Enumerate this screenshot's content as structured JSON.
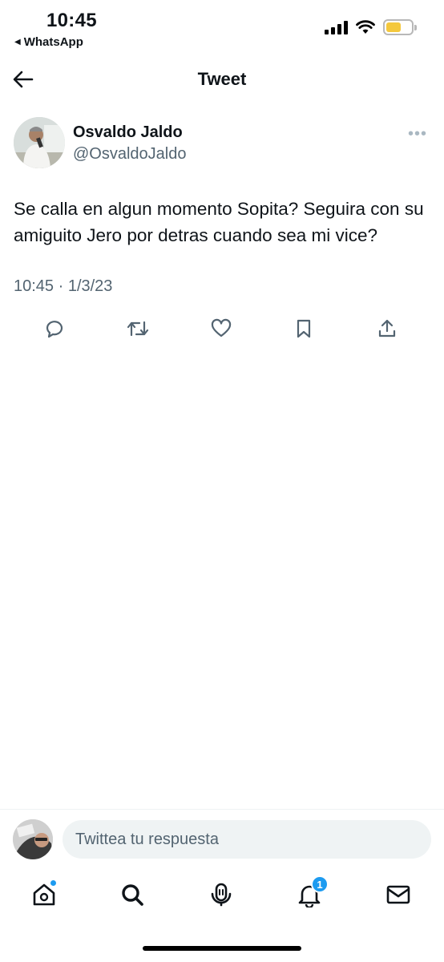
{
  "status_bar": {
    "time": "10:45",
    "back_app": "WhatsApp",
    "battery_color": "#f4c83d"
  },
  "header": {
    "title": "Tweet",
    "back_icon": "arrow-left-icon"
  },
  "tweet": {
    "author_name": "Osvaldo Jaldo",
    "author_handle": "@OsvaldoJaldo",
    "text": "Se calla en algun momento Sopita? Seguira con su amiguito Jero por detras cuando sea mi vice?",
    "timestamp": "10:45 · 1/3/23",
    "more_icon": "more-dots-icon",
    "actions": [
      {
        "name": "reply",
        "icon": "reply-icon"
      },
      {
        "name": "retweet",
        "icon": "retweet-icon"
      },
      {
        "name": "like",
        "icon": "heart-icon"
      },
      {
        "name": "bookmark",
        "icon": "bookmark-icon"
      },
      {
        "name": "share",
        "icon": "share-icon"
      }
    ]
  },
  "reply": {
    "placeholder": "Twittea tu respuesta"
  },
  "bottom_nav": {
    "items": [
      {
        "name": "home",
        "icon": "home-icon",
        "has_dot": true
      },
      {
        "name": "search",
        "icon": "search-icon"
      },
      {
        "name": "spaces",
        "icon": "spaces-icon"
      },
      {
        "name": "notifications",
        "icon": "bell-icon",
        "badge": "1"
      },
      {
        "name": "messages",
        "icon": "mail-icon"
      }
    ],
    "accent_color": "#1d9bf0"
  }
}
